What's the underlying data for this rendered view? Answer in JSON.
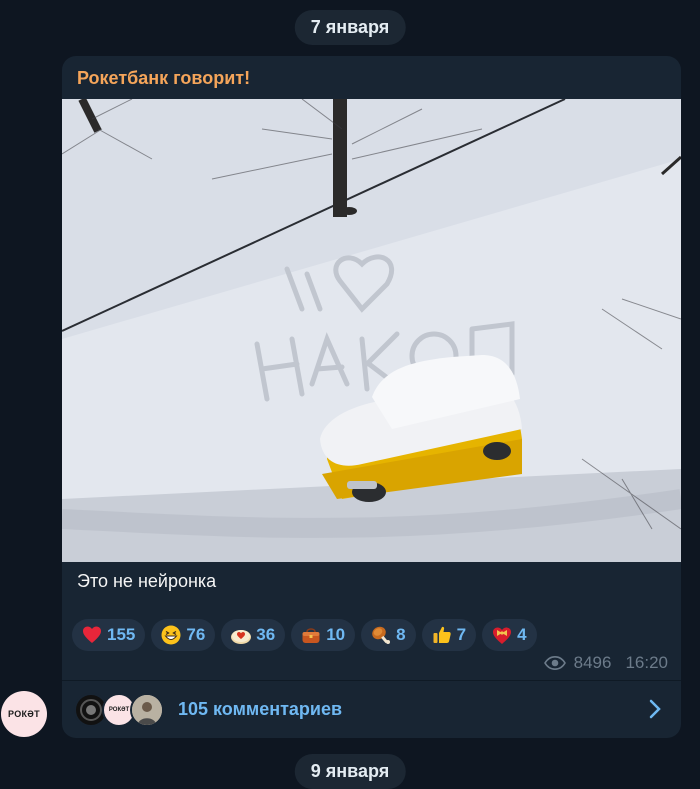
{
  "date_top": "7 января",
  "date_bottom": "9 января",
  "post": {
    "sender": "Рокетбанк говорит!",
    "photo_text": [
      "Я",
      "НАКОП"
    ],
    "caption": "Это не нейронка",
    "reactions": [
      {
        "icon": "heart-icon",
        "count": "155"
      },
      {
        "icon": "grinning-face-icon",
        "count": "76"
      },
      {
        "icon": "heart-cookie-icon",
        "count": "36"
      },
      {
        "icon": "purse-icon",
        "count": "10"
      },
      {
        "icon": "chicken-leg-icon",
        "count": "8"
      },
      {
        "icon": "thumbs-up-icon",
        "count": "7"
      },
      {
        "icon": "heart-bow-icon",
        "count": "4"
      }
    ],
    "views": "8496",
    "time": "16:20",
    "comments_label": "105 комментариев"
  },
  "channel": {
    "avatar_text": "РОКӘТ",
    "commenter_avatar_text": "РОКӘТ"
  },
  "colors": {
    "background": "#0e1621",
    "bubble": "#182533",
    "sender": "#f5a55a",
    "link": "#6fb8f2",
    "muted": "#6c7b8a"
  }
}
